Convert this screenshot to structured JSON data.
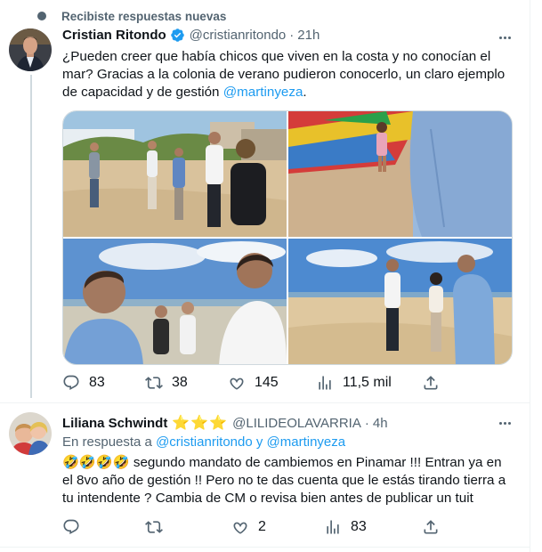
{
  "notice": {
    "text": "Recibiste respuestas nuevas"
  },
  "tweet1": {
    "name": "Cristian Ritondo",
    "verified_icon": "verified-badge-icon",
    "handle": "@cristianritondo",
    "separator": "·",
    "time": "21h",
    "text_part1": "¿Pueden creer que había chicos que viven en la costa y no conocían el mar? Gracias a la colonia de verano pudieron conocerlo, un claro ejemplo de capacidad y de gestión ",
    "mention": "@martinyeza",
    "text_part2": ".",
    "stats": {
      "replies": "83",
      "retweets": "38",
      "likes": "145",
      "views": "11,5 mil"
    }
  },
  "tweet2": {
    "name": "Liliana Schwindt",
    "stars": "⭐⭐⭐",
    "handle": "@LILIDEOLAVARRIA",
    "separator": "·",
    "time": "4h",
    "reply_prefix": "En respuesta a ",
    "reply_mentions": "@cristianritondo y @martinyeza",
    "emojis": "🤣🤣🤣🤣",
    "line1": " segundo mandato de cambiemos en Pinamar !!!  Entran ya en",
    "line2": "el 8vo año de gestión !! Pero no te das cuenta que le estás  tirando tierra a",
    "line3": "tu intendente ? Cambia de CM o revisa bien antes de publicar un tuit",
    "stats": {
      "replies": "",
      "retweets": "",
      "likes": "2",
      "views": "83"
    }
  },
  "colors": {
    "accent": "#1d9bf0",
    "muted": "#536471",
    "text": "#0f1419",
    "border": "#eff3f4",
    "star": "#f4b400"
  }
}
